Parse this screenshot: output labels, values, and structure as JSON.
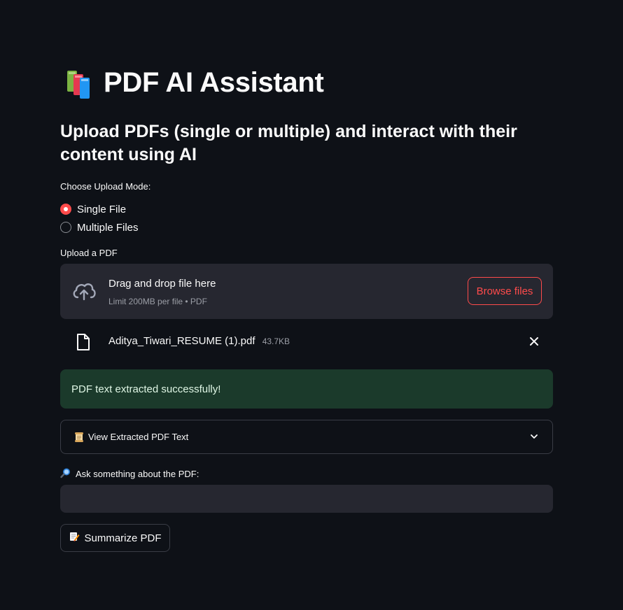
{
  "header": {
    "title_icon": "books-emoji-icon",
    "title": "PDF AI Assistant",
    "subtitle": "Upload PDFs (single or multiple) and interact with their content using AI"
  },
  "upload_mode": {
    "label": "Choose Upload Mode:",
    "options": [
      {
        "label": "Single File",
        "selected": true
      },
      {
        "label": "Multiple Files",
        "selected": false
      }
    ]
  },
  "uploader": {
    "label": "Upload a PDF",
    "dropzone_title": "Drag and drop file here",
    "dropzone_hint": "Limit 200MB per file • PDF",
    "browse_label": "Browse files",
    "icon": "cloud-upload-icon"
  },
  "uploaded_file": {
    "name": "Aditya_Tiwari_RESUME (1).pdf",
    "size": "43.7KB",
    "icon": "file-icon"
  },
  "status": {
    "message": "PDF text extracted successfully!"
  },
  "expander": {
    "icon": "scroll-emoji-icon",
    "label": "View Extracted PDF Text"
  },
  "question": {
    "icon": "magnifier-emoji-icon",
    "label": "Ask something about the PDF:",
    "value": ""
  },
  "actions": {
    "summarize_icon": "memo-emoji-icon",
    "summarize_label": "Summarize PDF"
  },
  "colors": {
    "background": "#0e1117",
    "accent": "#ff4b4b",
    "surface": "#262730",
    "success_bg": "#1b3a2b"
  }
}
